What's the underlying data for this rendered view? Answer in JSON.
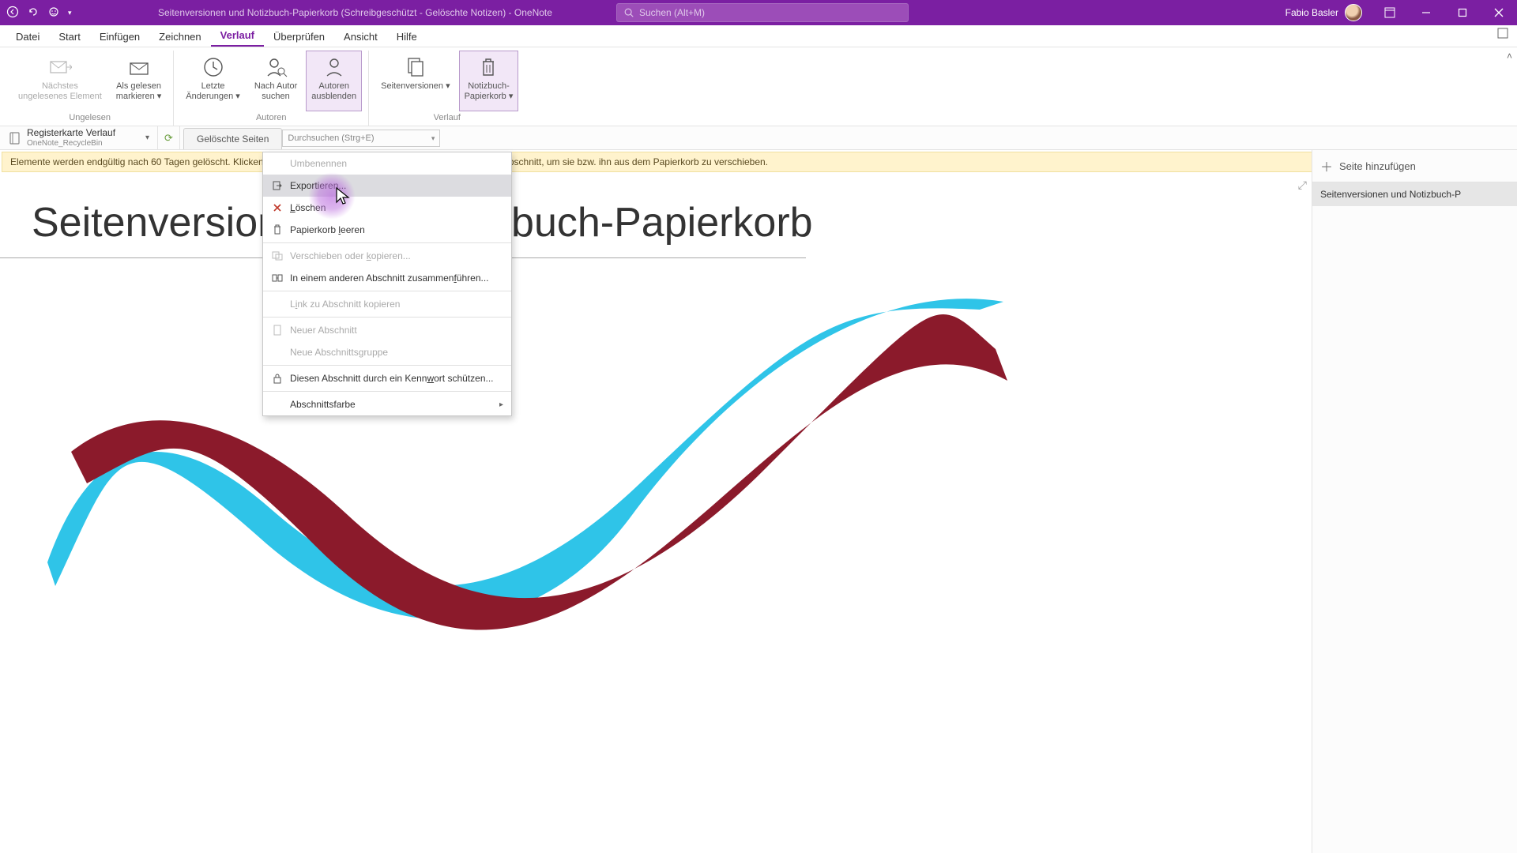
{
  "titlebar": {
    "title": "Seitenversionen und Notizbuch-Papierkorb (Schreibgeschützt - Gelöschte Notizen)  -  OneNote",
    "search_placeholder": "Suchen (Alt+M)",
    "user_name": "Fabio Basler"
  },
  "menu": {
    "tabs": [
      "Datei",
      "Start",
      "Einfügen",
      "Zeichnen",
      "Verlauf",
      "Überprüfen",
      "Ansicht",
      "Hilfe"
    ],
    "active_index": 4
  },
  "ribbon": {
    "groups": [
      {
        "label": "Ungelesen",
        "buttons": [
          {
            "label": "Nächstes\nungelesenes Element",
            "icon": "mail-next",
            "disabled": true
          },
          {
            "label": "Als gelesen\nmarkieren",
            "icon": "mail-read",
            "dropdown": true
          }
        ]
      },
      {
        "label": "Autoren",
        "buttons": [
          {
            "label": "Letzte\nÄnderungen",
            "icon": "clock",
            "dropdown": true
          },
          {
            "label": "Nach Autor\nsuchen",
            "icon": "person-search"
          },
          {
            "label": "Autoren\nausblenden",
            "icon": "person-hide",
            "active": true
          }
        ]
      },
      {
        "label": "Verlauf",
        "buttons": [
          {
            "label": "Seitenversionen",
            "icon": "page-versions",
            "dropdown": true
          },
          {
            "label": "Notizbuch-\nPapierkorb",
            "icon": "trash",
            "dropdown": true,
            "active": true
          }
        ]
      }
    ]
  },
  "notebook": {
    "line1": "Registerkarte Verlauf",
    "line2": "OneNote_RecycleBin",
    "sync_symbol": "⟳"
  },
  "section_tab": "Gelöschte Seiten",
  "search_pages_placeholder": "Durchsuchen (Strg+E)",
  "infobar": "Elemente werden endgültig nach 60 Tagen gelöscht. Klicken Sie mit der rechten Maustaste auf eine Seite oder einen Abschnitt, um sie bzw. ihn aus dem Papierkorb zu verschieben.",
  "page_title": "Seitenversionen und Notizbuch-Papierkorb",
  "pagelist": {
    "add": "Seite hinzufügen",
    "current": "Seitenversionen und Notizbuch-P"
  },
  "ctx": {
    "rename": "Umbenennen",
    "export": "Exportieren...",
    "delete": "Löschen",
    "empty": "Papierkorb leeren",
    "move_seg": [
      "Verschieben oder ",
      "k",
      "opieren..."
    ],
    "merge_seg": [
      "In einem anderen Abschnitt zusammen",
      "f",
      "ühren..."
    ],
    "copylink_seg": [
      "L",
      "i",
      "nk zu Abschnitt kopieren"
    ],
    "newsect": "Neuer Abschnitt",
    "newgroup": "Neue Abschnittsgruppe",
    "protect_seg": [
      "Diesen Abschnitt durch ein Kenn",
      "w",
      "ort schützen..."
    ],
    "color": "Abschnittsfarbe"
  }
}
